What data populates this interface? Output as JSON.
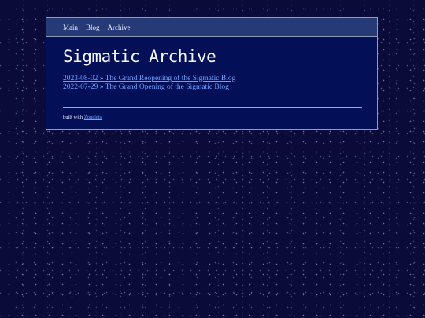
{
  "nav": {
    "items": [
      {
        "label": "Main"
      },
      {
        "label": "Blog"
      },
      {
        "label": "Archive"
      }
    ]
  },
  "header": {
    "title": "Sigmatic Archive"
  },
  "posts": [
    {
      "text": "2023-08-02 » The Grand Reopening of the Sigmatic Blog"
    },
    {
      "text": "2022-07-29 » The Grand Opening of the Sigmatic Blog"
    }
  ],
  "footer": {
    "prefix": "built with",
    "link": "Zonelets"
  },
  "colors": {
    "background": "#0b0b3a",
    "panel": "#031058",
    "nav_bar": "#273a78",
    "link": "#6fa0ff",
    "text": "#e8ecff"
  }
}
